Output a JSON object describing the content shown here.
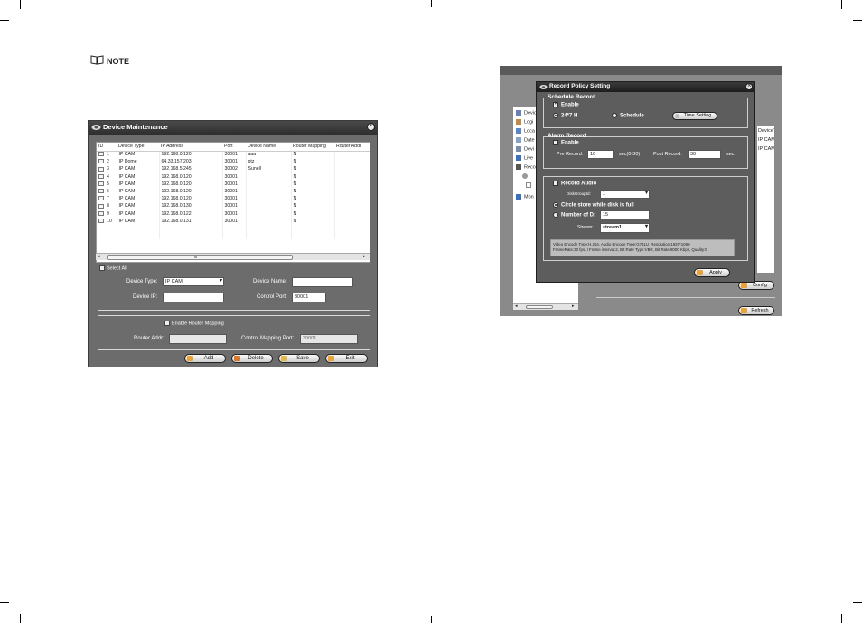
{
  "note": {
    "label": "NOTE"
  },
  "device_window": {
    "title": "Device Maintenance",
    "columns": [
      "ID",
      "Device Type",
      "IP Address",
      "Port",
      "Device Name",
      "Router Mapping",
      "Router Addr"
    ],
    "rows": [
      [
        "1",
        "IP CAM",
        "192.168.0.120",
        "30001",
        "aaa",
        "N",
        ""
      ],
      [
        "2",
        "IP Dome",
        "64.33.157.203",
        "30001",
        "ptz",
        "N",
        ""
      ],
      [
        "3",
        "IP CAM",
        "192.168.5.245",
        "30002",
        "Sunell",
        "N",
        ""
      ],
      [
        "4",
        "IP CAM",
        "192.168.0.120",
        "30001",
        "",
        "N",
        ""
      ],
      [
        "5",
        "IP CAM",
        "192.168.0.120",
        "30001",
        "",
        "N",
        ""
      ],
      [
        "6",
        "IP CAM",
        "192.168.0.120",
        "30001",
        "",
        "N",
        ""
      ],
      [
        "7",
        "IP CAM",
        "192.168.0.120",
        "30001",
        "",
        "N",
        ""
      ],
      [
        "8",
        "IP CAM",
        "192.168.0.130",
        "30001",
        "",
        "N",
        ""
      ],
      [
        "9",
        "IP CAM",
        "192.168.0.122",
        "30001",
        "",
        "N",
        ""
      ],
      [
        "10",
        "IP CAM",
        "192.168.0.131",
        "30001",
        "",
        "N",
        ""
      ]
    ],
    "scroll_mark": "III",
    "select_all": "Select All",
    "device_type_label": "Device Type:",
    "device_type_value": "IP CAM",
    "device_name_label": "Device Name:",
    "device_name_value": "",
    "device_ip_label": "Device IP:",
    "device_ip_value": "",
    "control_port_label": "Control Port:",
    "control_port_value": "30001",
    "enable_router_label": "Enable Router Mapping",
    "router_addr_label": "Router Addr:",
    "router_addr_value": "",
    "control_mapping_port_label": "Control Mapping Port:",
    "control_mapping_port_value": "30001",
    "buttons": {
      "add": "Add",
      "delete": "Delete",
      "save": "Save",
      "exit": "Exit"
    }
  },
  "background_app": {
    "tree": [
      "Devic",
      "Logi",
      "Loca",
      "Date",
      "Devi",
      "Live",
      "Reco",
      "",
      "",
      "Mon"
    ],
    "list_header": "DeviceT",
    "list_rows": [
      "IP CAM",
      "IP CAM"
    ],
    "config_button": "Config",
    "refresh_button": "Refresh"
  },
  "record_dialog": {
    "title": "Record Policy Setting",
    "schedule_group": "Schedule Record",
    "schedule_enable": "Enable",
    "radio_247": "24*7 H",
    "radio_schedule": "Schedule",
    "time_setting": "Time Setting",
    "alarm_group": "Alarm Record",
    "alarm_enable": "Enable",
    "pre_record_label": "Pre Record:",
    "pre_record_value": "10",
    "pre_record_unit": "sec(0-30)",
    "post_record_label": "Post Record:",
    "post_record_value": "30",
    "post_record_unit": "sec",
    "record_audio": "Record Audio",
    "disk_group_label": "DiskGroupId:",
    "disk_group_value": "1",
    "circle_store": "Circle store while disk is full",
    "number_of_d": "Number of D:",
    "number_of_d_value": "15",
    "stream_label": "Stream:",
    "stream_value": "stream1",
    "info_line1": "Video Encode Type:H.264, Audio Encode Type:G711U, Resolution:1920*1080",
    "info_line2": "FrameRate:30 fps, I Frame interval:2, Bit Rate Type:VBR, Bit Rate:8000 Kbps, Quality:5",
    "apply": "Apply"
  }
}
